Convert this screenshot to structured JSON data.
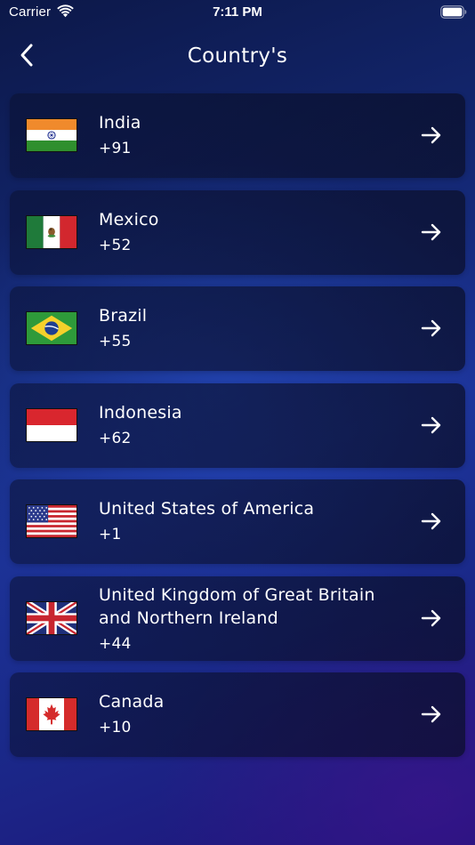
{
  "status_bar": {
    "carrier": "Carrier",
    "time": "7:11 PM",
    "wifi_icon": "wifi-icon",
    "battery_icon": "battery-icon"
  },
  "nav": {
    "back_icon": "chevron-left-icon",
    "title": "Country's"
  },
  "theme": {
    "text": "#ffffff",
    "card_bg": "#0c1234",
    "bg_top": "#0c1848",
    "bg_mid": "#1c3296",
    "bg_bottom": "#20137a"
  },
  "countries": [
    {
      "name": "India",
      "code": "+91",
      "flag_icon": "india-flag-icon",
      "arrow_icon": "arrow-right-icon"
    },
    {
      "name": "Mexico",
      "code": "+52",
      "flag_icon": "mexico-flag-icon",
      "arrow_icon": "arrow-right-icon"
    },
    {
      "name": "Brazil",
      "code": "+55",
      "flag_icon": "brazil-flag-icon",
      "arrow_icon": "arrow-right-icon"
    },
    {
      "name": "Indonesia",
      "code": "+62",
      "flag_icon": "indonesia-flag-icon",
      "arrow_icon": "arrow-right-icon"
    },
    {
      "name": "United States of America",
      "code": "+1",
      "flag_icon": "usa-flag-icon",
      "arrow_icon": "arrow-right-icon"
    },
    {
      "name": "United Kingdom of Great Britain and Northern Ireland",
      "code": "+44",
      "flag_icon": "uk-flag-icon",
      "arrow_icon": "arrow-right-icon"
    },
    {
      "name": "Canada",
      "code": "+10",
      "flag_icon": "canada-flag-icon",
      "arrow_icon": "arrow-right-icon"
    }
  ]
}
